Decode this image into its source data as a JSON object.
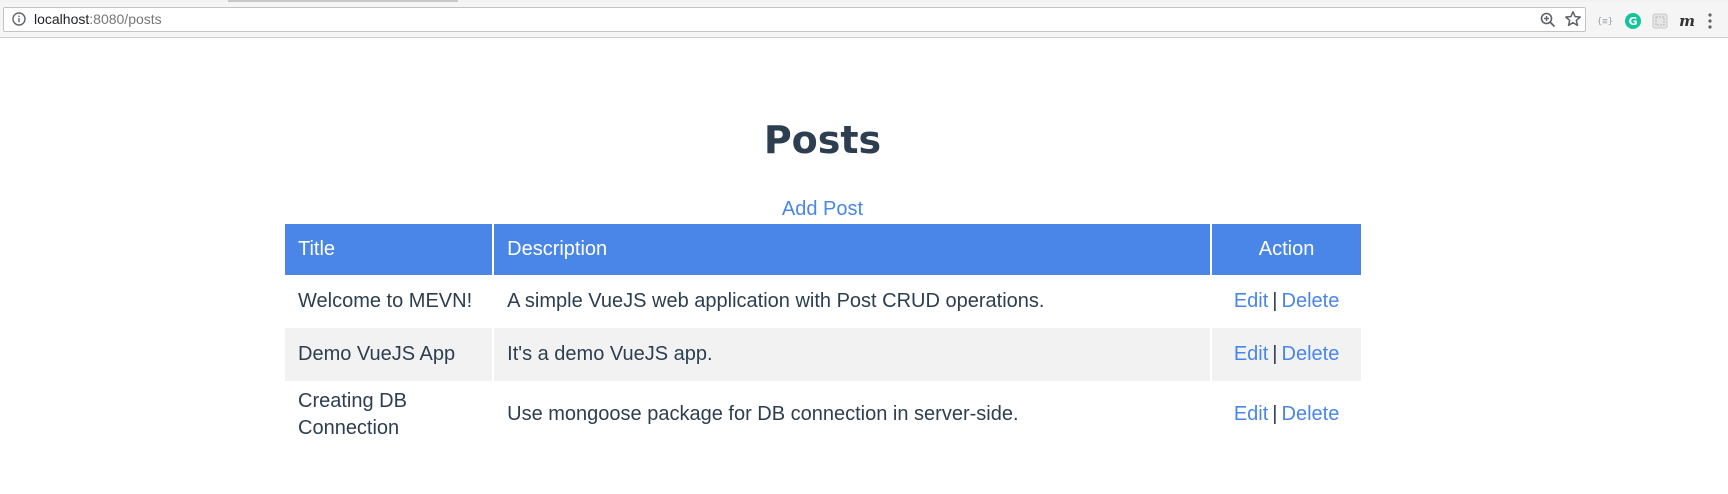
{
  "browser": {
    "url_host": "localhost",
    "url_path": ":8080/posts",
    "extensions": [
      {
        "name": "code-extension-icon",
        "glyph": "{≡}"
      },
      {
        "name": "grammarly-icon",
        "glyph": "G",
        "color": "#15c39a"
      },
      {
        "name": "screenshot-extension-icon",
        "glyph": ""
      },
      {
        "name": "m-extension-icon",
        "glyph": "m"
      }
    ]
  },
  "page": {
    "title": "Posts",
    "add_post_label": "Add Post"
  },
  "table": {
    "headers": [
      "Title",
      "Description",
      "Action"
    ],
    "rows": [
      {
        "title": "Welcome to MEVN!",
        "description": "A simple VueJS web application with Post CRUD operations.",
        "edit": "Edit",
        "sep": "|",
        "delete": "Delete"
      },
      {
        "title": "Demo VueJS App",
        "description": "It's a demo VueJS app.",
        "edit": "Edit",
        "sep": "|",
        "delete": "Delete"
      },
      {
        "title": "Creating DB Connection",
        "description": "Use mongoose package for DB connection in server-side.",
        "edit": "Edit",
        "sep": "|",
        "delete": "Delete"
      }
    ]
  },
  "colors": {
    "accent": "#4a86e8",
    "text": "#2c3e50",
    "row_alt": "#f2f2f2"
  }
}
